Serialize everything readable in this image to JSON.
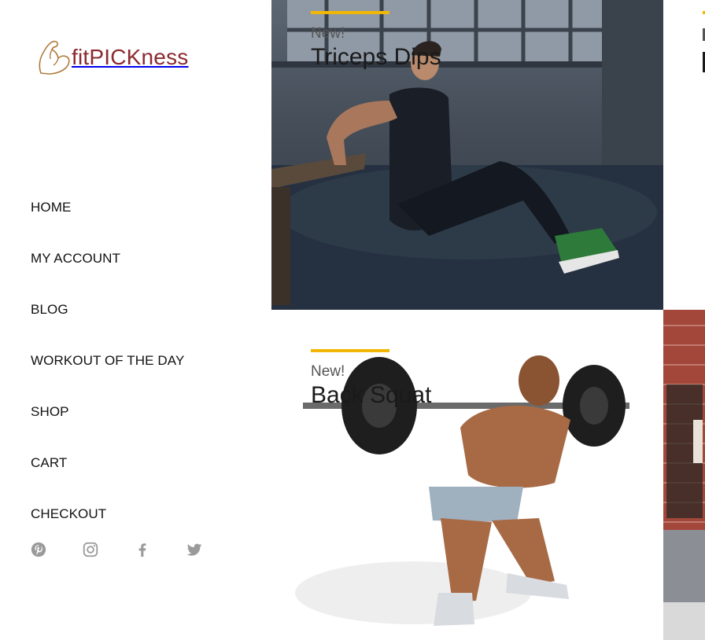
{
  "brand": {
    "logo_text": "fitPICKness",
    "logo_color": "#8b2a2f"
  },
  "nav": {
    "items": [
      {
        "label": "HOME"
      },
      {
        "label": "MY ACCOUNT"
      },
      {
        "label": "BLOG"
      },
      {
        "label": "WORKOUT OF THE DAY"
      },
      {
        "label": "SHOP"
      },
      {
        "label": "CART"
      },
      {
        "label": "CHECKOUT"
      }
    ]
  },
  "social": {
    "icons": [
      "pinterest-icon",
      "instagram-icon",
      "facebook-icon",
      "twitter-icon"
    ],
    "color": "#9a9a9a"
  },
  "tiles": [
    {
      "tag": "New!",
      "title": "Triceps Dips",
      "accent": "#f2b705"
    },
    {
      "tag": "New!",
      "title": "Back Squat",
      "accent": "#f2b705"
    }
  ]
}
